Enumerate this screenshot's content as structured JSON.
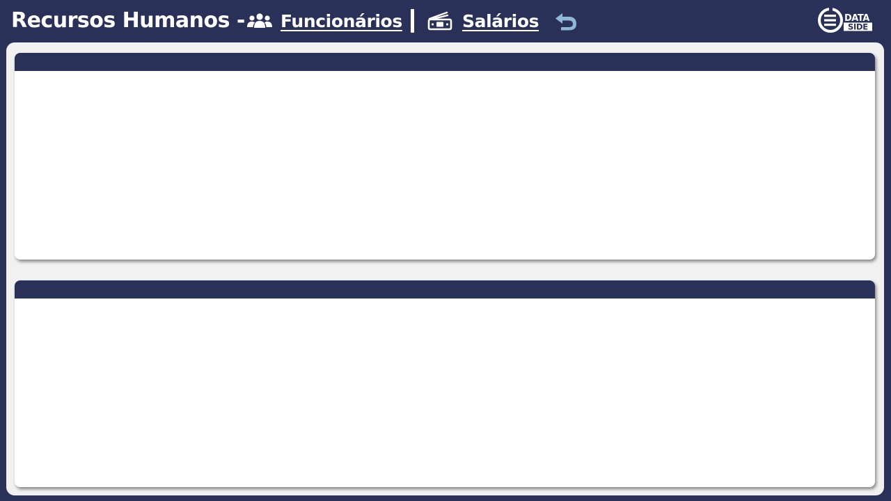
{
  "header": {
    "title": "Recursos Humanos -",
    "nav": {
      "funcionarios": {
        "label": "Funcionários",
        "icon": "users-icon"
      },
      "salarios": {
        "label": "Salários",
        "icon": "money-icon"
      }
    },
    "back_icon": "back-arrow-icon",
    "logo": {
      "line1": "DATA",
      "line2": "SIDE"
    }
  },
  "colors": {
    "primary": "#2a3158",
    "background": "#f1f1f1",
    "card": "#ffffff",
    "back_arrow": "#8fb8d8"
  }
}
